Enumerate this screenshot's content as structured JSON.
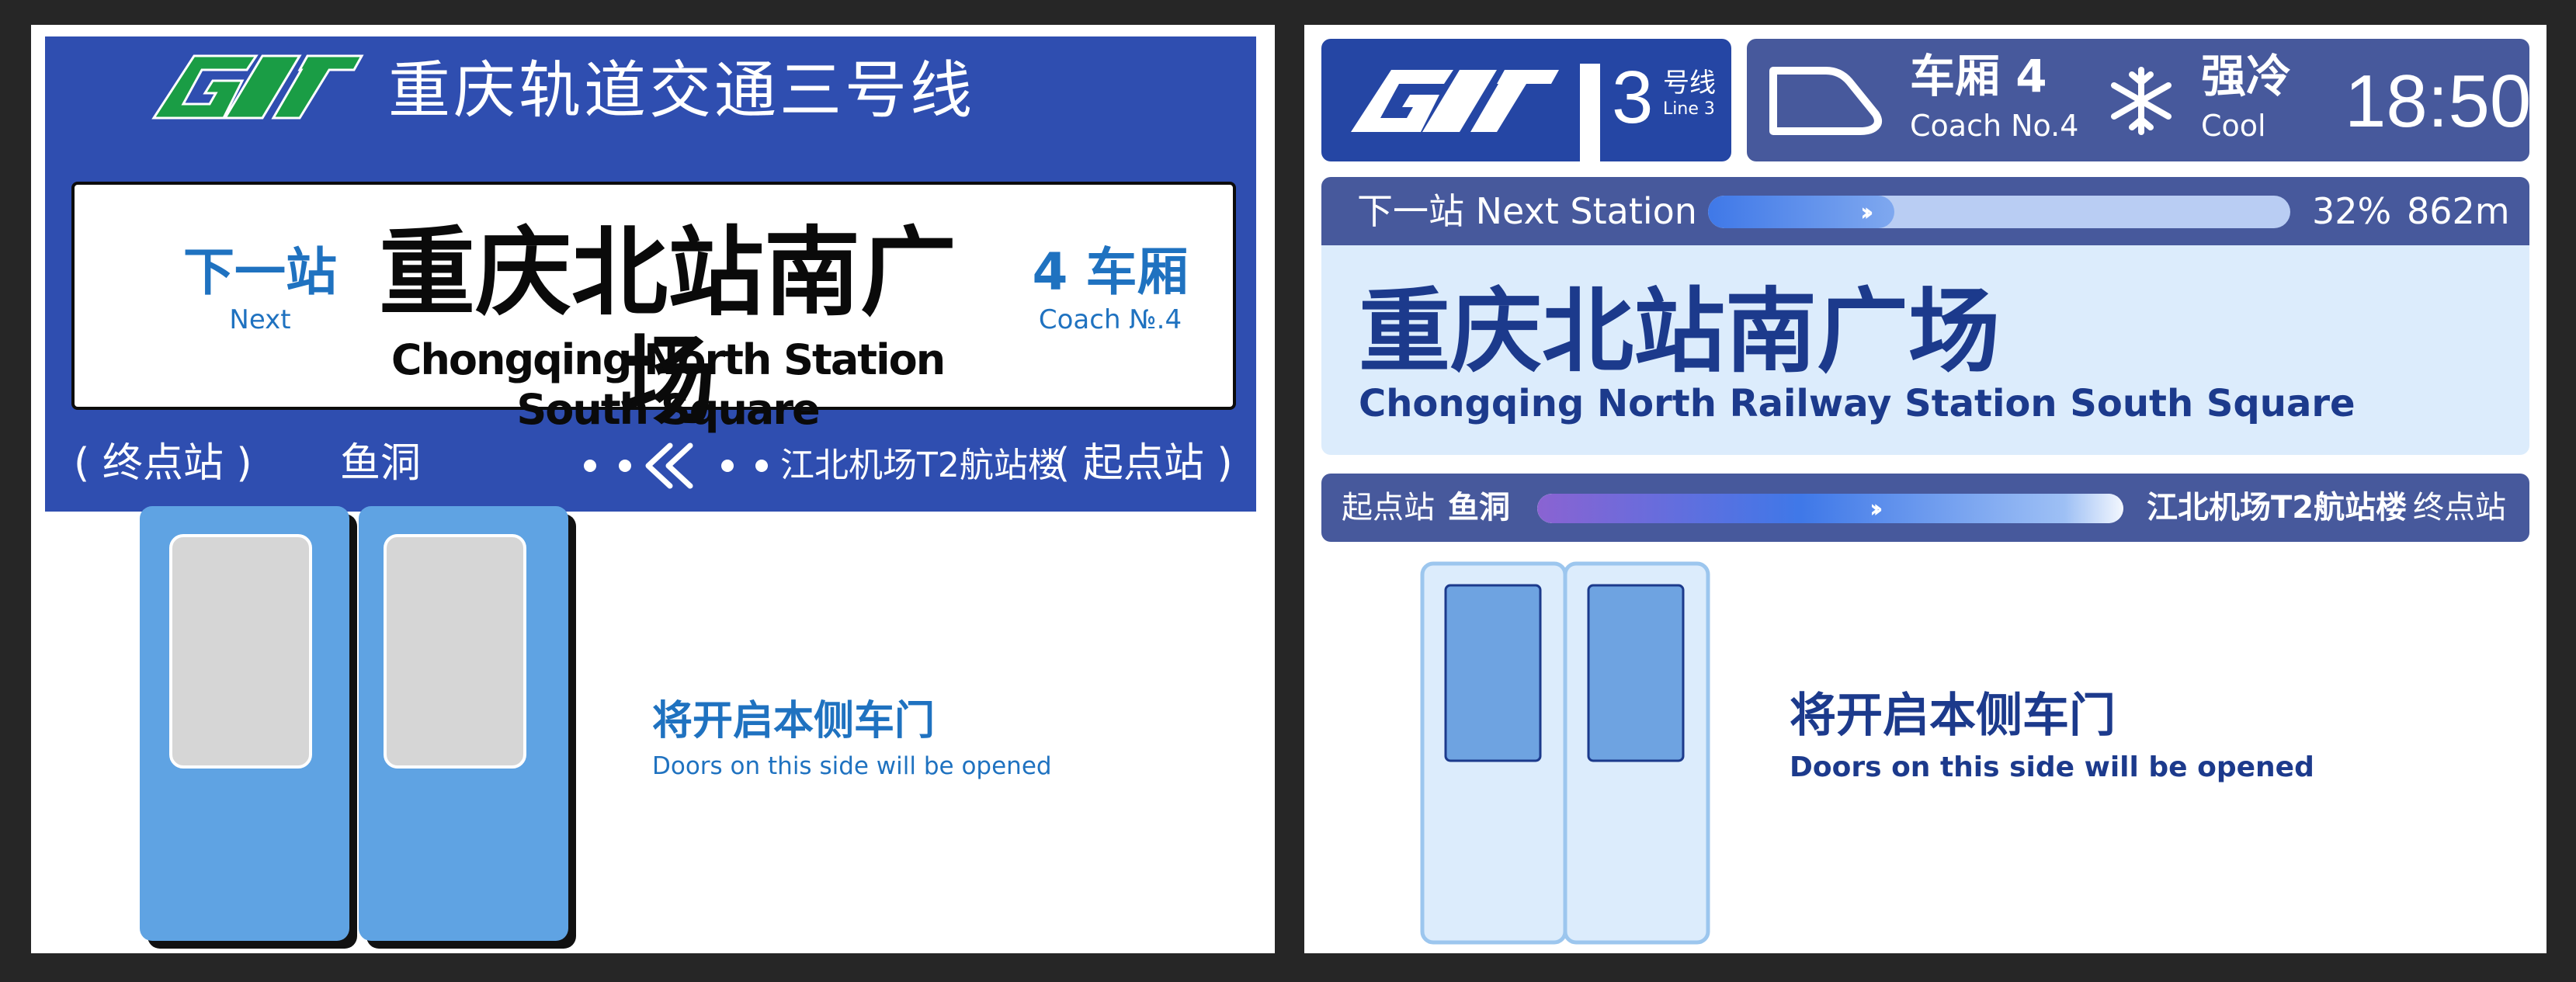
{
  "left_panel": {
    "title": "重庆轨道交通三号线",
    "next_label_cn": "下一站",
    "next_label_en": "Next",
    "station_cn": "重庆北站南广场",
    "station_en": "Chongqing North Station South Square",
    "coach_cn": "4 车厢",
    "coach_en": "Coach №.4",
    "terminal_label": "( 终点站 )",
    "terminal_station": "鱼洞",
    "origin_station": "江北机场T2航站楼",
    "origin_label": "( 起点站 )",
    "door_cn": "将开启本侧车门",
    "door_en": "Doors on this side will be opened"
  },
  "right_panel": {
    "line_number": "3",
    "line_cn": "号线",
    "line_en": "Line 3",
    "coach_cn": "车厢 4",
    "coach_en": "Coach No.4",
    "climate_cn": "强冷",
    "climate_en": "Cool",
    "time": "18:50",
    "next_station_label": "下一站 Next Station",
    "progress_percent_text": "32%",
    "progress_fraction": 0.32,
    "distance": "862m",
    "station_cn": "重庆北站南广场",
    "station_en": "Chongqing North Railway Station South Square",
    "route_origin_label": "起点站",
    "route_origin": "鱼洞",
    "route_dest": "江北机场T2航站楼",
    "route_dest_label": "终点站",
    "door_cn": "将开启本侧车门",
    "door_en": "Doors on this side will be opened"
  },
  "icons": {
    "logo": "cqrt-logo-icon",
    "train": "train-icon",
    "climate": "snowflake-icon",
    "direction": "chevron-left-icon"
  },
  "colors": {
    "old_blue": "#2f4eb0",
    "old_text_blue": "#1f72c0",
    "new_navy": "#2546a4",
    "new_slate": "#47599c",
    "new_light": "#dcecfc",
    "logo_green": "#1a9d45"
  }
}
